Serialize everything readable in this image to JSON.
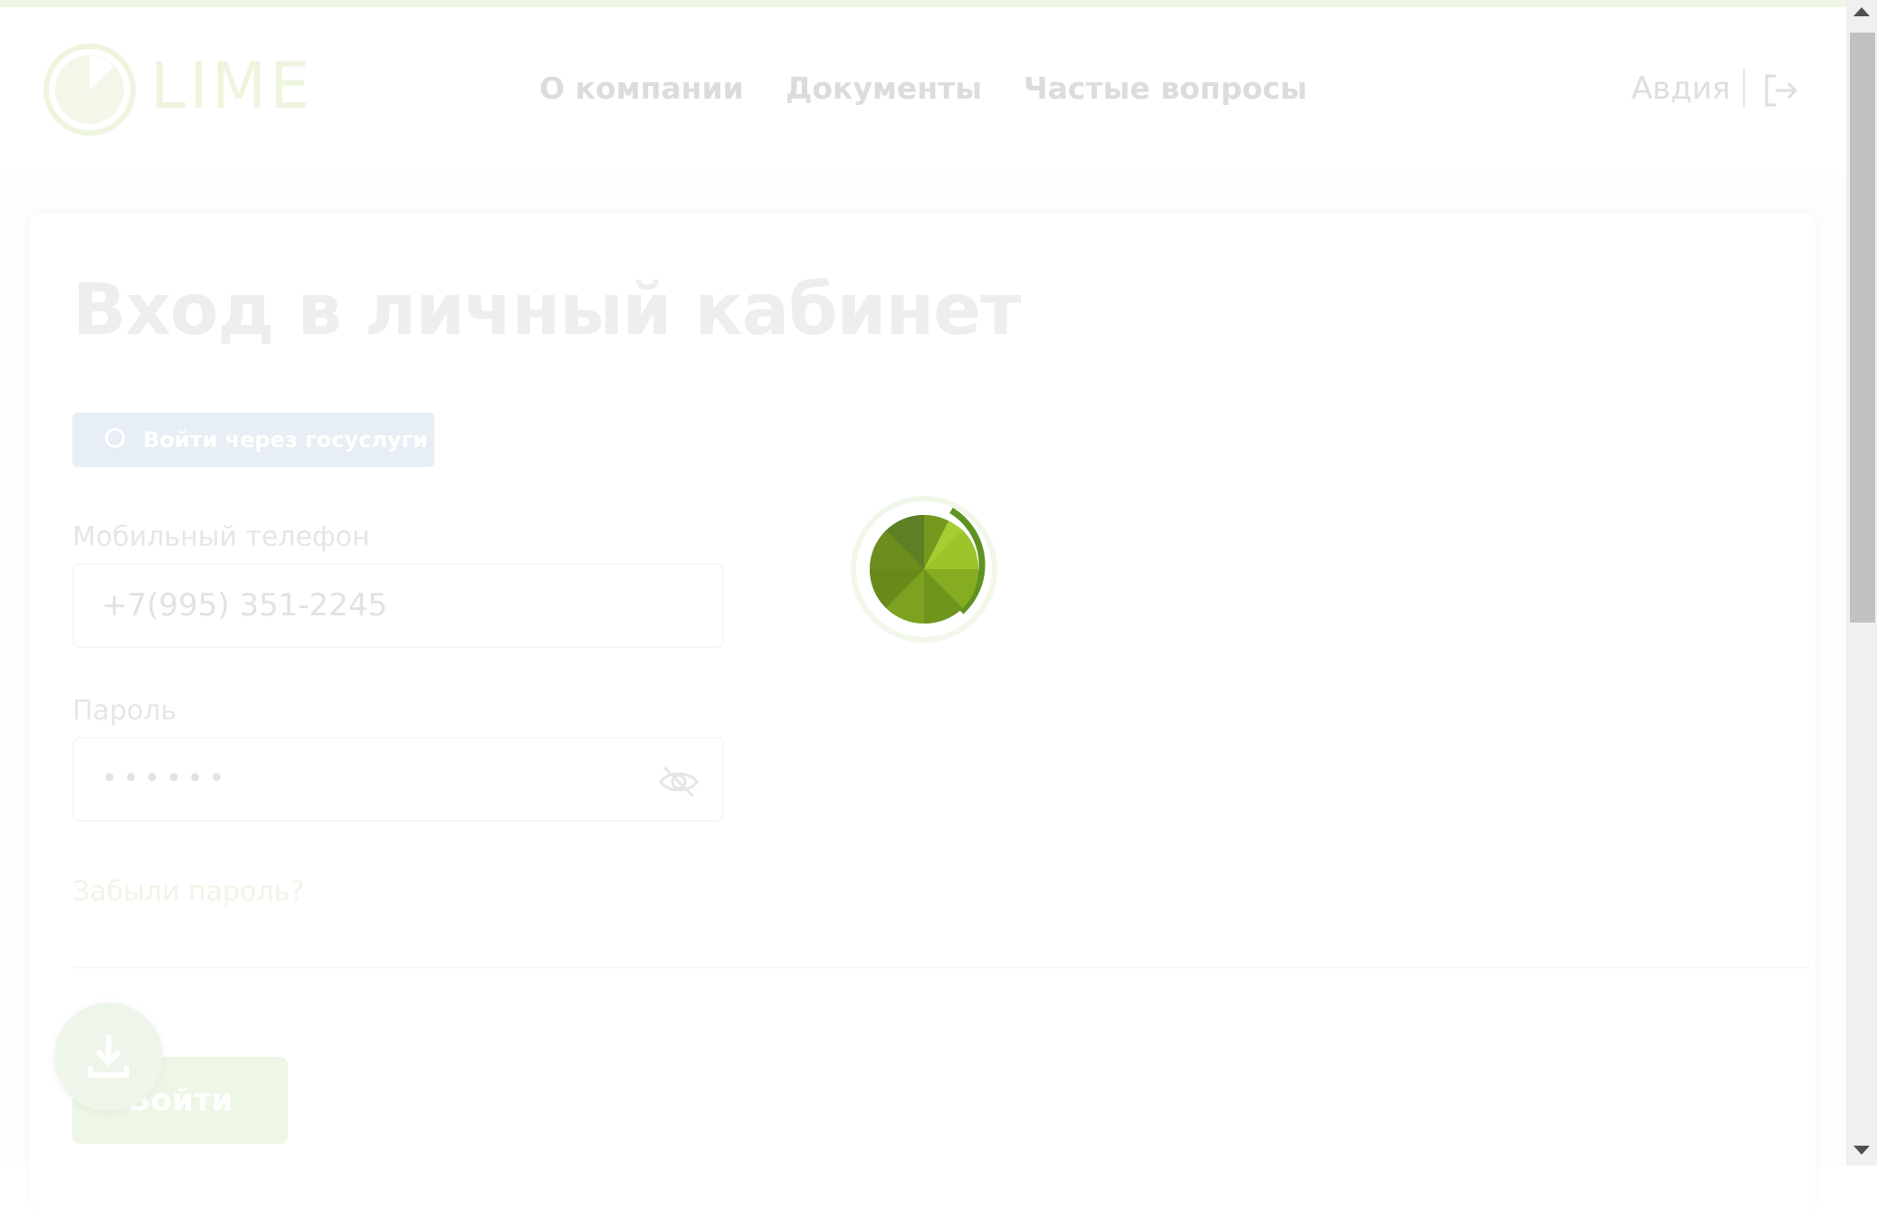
{
  "header": {
    "logo_text": "LIME",
    "nav": [
      {
        "label": "О компании"
      },
      {
        "label": "Документы"
      },
      {
        "label": "Частые вопросы"
      }
    ],
    "user_name": "Авдия"
  },
  "login": {
    "title": "Вход в личный кабинет",
    "gosuslugi_label": "Войти через госуслуги",
    "phone_label": "Мобильный телефон",
    "phone_value": "+7(995) 351-2245",
    "password_label": "Пароль",
    "password_value": "••••••",
    "forgot_label": "Забыли пароль?",
    "submit_label": "Войти"
  },
  "colors": {
    "brand_green": "#6a9a1f",
    "spinner_light": "#9bc52b",
    "gosuslugi_blue": "#e8eef5"
  }
}
